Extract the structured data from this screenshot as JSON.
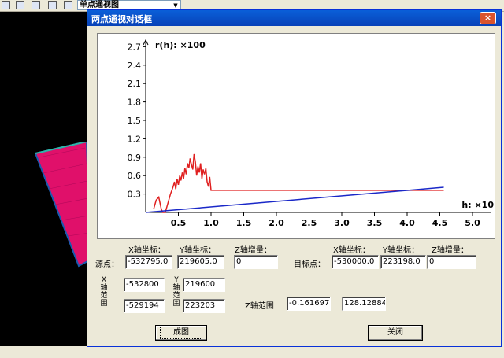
{
  "app": {
    "combo_value": "单点通视图"
  },
  "dialog": {
    "title": "两点通视对话框",
    "close_label": "×",
    "chart_data": {
      "type": "line",
      "ylabel": "r(h): ×100",
      "xlabel": "h: ×10",
      "x_ticks": [
        "0.5",
        "1.0",
        "1.5",
        "2.0",
        "2.5",
        "3.0",
        "3.5",
        "4.0",
        "4.5",
        "5.0"
      ],
      "y_ticks": [
        "0.3",
        "0.6",
        "0.9",
        "1.2",
        "1.5",
        "1.8",
        "2.1",
        "2.4",
        "2.7"
      ],
      "xlim": [
        0,
        5.0
      ],
      "ylim": [
        0,
        2.7
      ],
      "series": [
        {
          "color": "#e02020",
          "x": [
            0.12,
            0.16,
            0.2,
            0.24,
            0.26,
            0.3,
            0.34,
            0.38,
            0.42,
            0.44,
            0.46,
            0.48,
            0.5,
            0.52,
            0.54,
            0.56,
            0.58,
            0.6,
            0.62,
            0.64,
            0.66,
            0.68,
            0.7,
            0.72,
            0.74,
            0.76,
            0.78,
            0.8,
            0.82,
            0.84,
            0.86,
            0.88,
            0.9,
            0.92,
            0.94,
            0.96,
            0.98,
            1.0,
            4.56
          ],
          "y": [
            0.05,
            0.2,
            0.25,
            0.05,
            0.0,
            0.0,
            0.15,
            0.3,
            0.42,
            0.5,
            0.38,
            0.55,
            0.45,
            0.6,
            0.52,
            0.65,
            0.55,
            0.72,
            0.62,
            0.8,
            0.72,
            0.88,
            0.78,
            0.7,
            0.95,
            0.82,
            0.6,
            0.75,
            0.65,
            0.8,
            0.55,
            0.7,
            0.62,
            0.72,
            0.5,
            0.42,
            0.58,
            0.36,
            0.36
          ]
        },
        {
          "color": "#1a28c8",
          "x": [
            0.0,
            4.56
          ],
          "y": [
            0.0,
            0.41
          ]
        }
      ]
    },
    "source": {
      "label": "源点：",
      "x_header": "X轴坐标：",
      "y_header": "Y轴坐标：",
      "z_header": "Z轴增量：",
      "x": "-532795.0",
      "y": "219605.0",
      "z": "0"
    },
    "target": {
      "label": "目标点：",
      "x_header": "X轴坐标：",
      "y_header": "Y轴坐标：",
      "z_header": "Z轴增量：",
      "x": "-530000.0",
      "y": "223198.0",
      "z": "0"
    },
    "range": {
      "x_label": "X轴范围",
      "y_label": "Y轴范围",
      "x_min": "-532800",
      "x_max": "-529194",
      "y_min": "219600",
      "y_max": "223203",
      "z_label": "Z轴范围",
      "z_min": "-0.1616971",
      "z_max": "128.12884("
    },
    "buttons": {
      "draw": "成图",
      "close": "关闭"
    }
  }
}
